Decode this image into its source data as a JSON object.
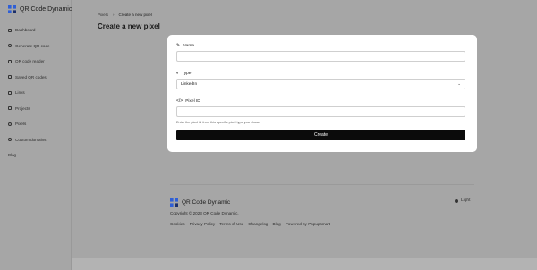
{
  "brand": {
    "name": "QR Code Dynamic",
    "accent": "#2f5fd6"
  },
  "sidebar": {
    "items": [
      {
        "label": "Dashboard",
        "icon": "grid-icon"
      },
      {
        "label": "Generate QR code",
        "icon": "settings-icon"
      },
      {
        "label": "QR code reader",
        "icon": "scan-icon"
      },
      {
        "label": "Saved QR codes",
        "icon": "qrcode-icon"
      },
      {
        "label": "Links",
        "icon": "link-icon"
      },
      {
        "label": "Projects",
        "icon": "projects-icon"
      },
      {
        "label": "Pixels",
        "icon": "pixel-icon"
      },
      {
        "label": "Custom domains",
        "icon": "globe-icon"
      },
      {
        "label": "Blog",
        "icon": ""
      }
    ]
  },
  "breadcrumb": {
    "parent": "Pixels",
    "separator": "›",
    "current": "Create a new pixel"
  },
  "page": {
    "title": "Create a new pixel"
  },
  "form": {
    "name": {
      "label": "Name",
      "value": "",
      "placeholder": ""
    },
    "type": {
      "label": "Type",
      "value": "LinkedIn"
    },
    "pixel_id": {
      "label": "Pixel ID",
      "value": "",
      "placeholder": "",
      "help": "Enter the pixel id from this specific pixel type you chose."
    },
    "submit_label": "Create"
  },
  "footer": {
    "brand": "QR Code Dynamic",
    "copyright": "Copyright © 2023 QR Code Dynamic.",
    "links": [
      "Cookies",
      "Privacy Policy",
      "Terms of Use",
      "Changelog",
      "Blog",
      "Powered by Popupsmart"
    ],
    "theme": "Light"
  }
}
